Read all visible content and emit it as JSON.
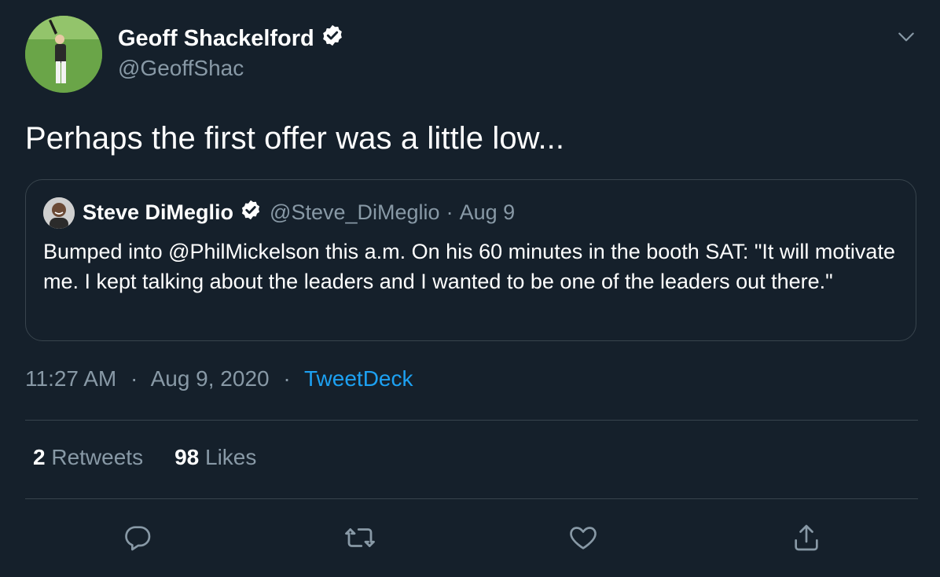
{
  "author": {
    "name": "Geoff Shackelford",
    "handle": "@GeoffShac",
    "verified": true
  },
  "tweet": {
    "text": "Perhaps the first offer was a little low..."
  },
  "quoted": {
    "name": "Steve DiMeglio",
    "handle": "@Steve_DiMeglio",
    "separator": "·",
    "date": "Aug 9",
    "verified": true,
    "text": "Bumped into @PhilMickelson this a.m. On his 60 minutes in the booth SAT: \"It will motivate me. I kept talking about the leaders and I wanted to be one of the leaders out there.\""
  },
  "meta": {
    "time": "11:27 AM",
    "sep1": "·",
    "date": "Aug 9, 2020",
    "sep2": "·",
    "source": "TweetDeck"
  },
  "stats": {
    "retweets_count": "2",
    "retweets_label": "Retweets",
    "likes_count": "98",
    "likes_label": "Likes"
  },
  "icons": {
    "caret": "chevron-down-icon",
    "reply": "reply-icon",
    "retweet": "retweet-icon",
    "like": "heart-icon",
    "share": "share-icon",
    "verified": "verified-badge-icon"
  },
  "colors": {
    "background": "#15202b",
    "text": "#ffffff",
    "secondary": "#8899a6",
    "accent": "#1da1f2",
    "border": "#38444d"
  }
}
